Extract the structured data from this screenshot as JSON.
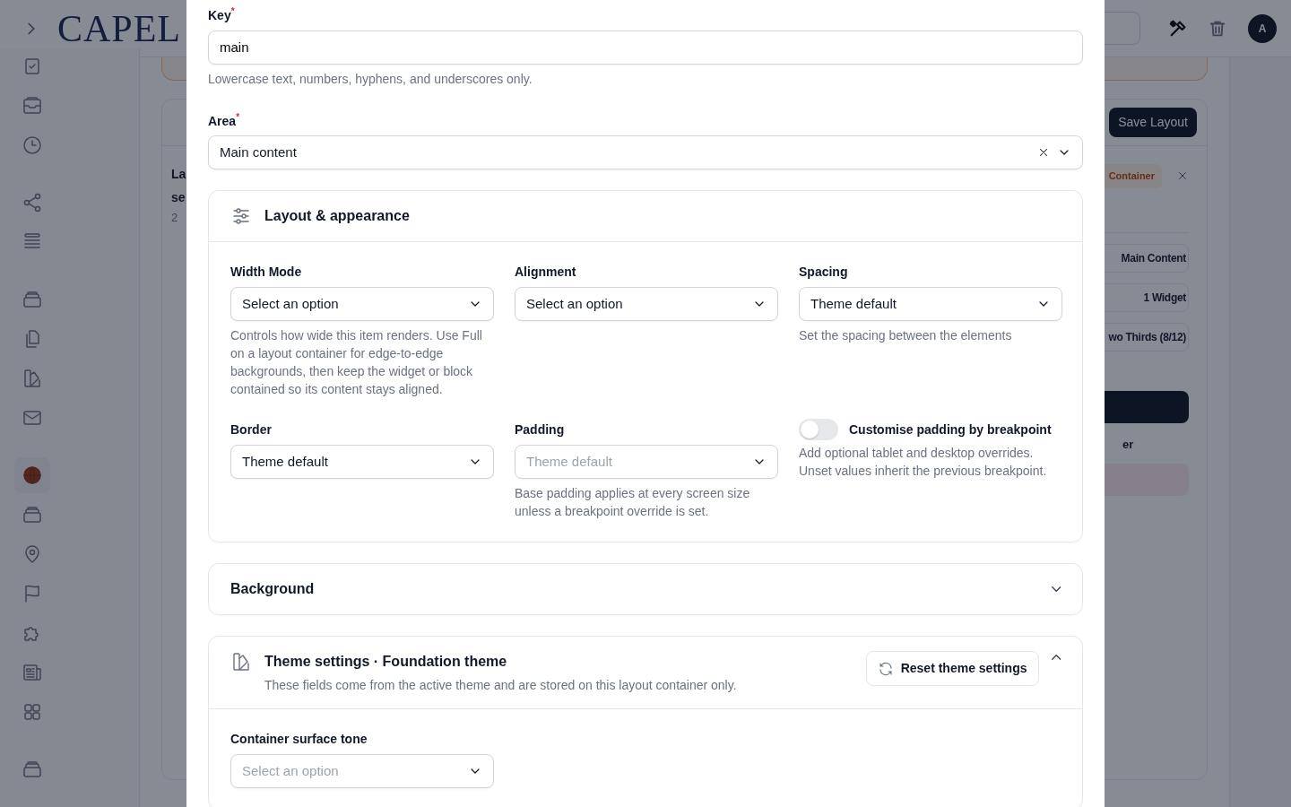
{
  "header": {
    "logo": "CAPEL",
    "avatar": "A"
  },
  "sidebar": {
    "groups": [
      [
        {
          "kind": "check",
          "selected": false
        },
        {
          "kind": "inbox",
          "selected": false
        },
        {
          "kind": "clock",
          "selected": false
        }
      ],
      [
        {
          "kind": "share",
          "selected": false
        },
        {
          "kind": "list",
          "selected": false
        }
      ],
      [
        {
          "kind": "archive",
          "selected": false
        },
        {
          "kind": "files",
          "selected": false
        },
        {
          "kind": "swatch",
          "selected": false
        },
        {
          "kind": "mail",
          "selected": false
        }
      ],
      [
        {
          "kind": "globe",
          "selected": true
        },
        {
          "kind": "archive",
          "selected": false
        },
        {
          "kind": "pin",
          "selected": false
        },
        {
          "kind": "flag",
          "selected": false
        },
        {
          "kind": "puzzle",
          "selected": false
        },
        {
          "kind": "news",
          "selected": false
        },
        {
          "kind": "grid",
          "selected": false
        }
      ],
      [
        {
          "kind": "archive",
          "selected": false
        }
      ]
    ]
  },
  "layout_card": {
    "title_lines": [
      "La",
      "se"
    ],
    "count": "2",
    "save_button": "Save Layout",
    "badge": "Container",
    "rows": [
      "Main Content",
      "1 Widget",
      "wo Thirds (8/12)"
    ],
    "footer_text": "er"
  },
  "modal": {
    "fields": [
      {
        "label": "Key",
        "required_mark": "*",
        "kind": "text",
        "value": "main",
        "help": "Lowercase text, numbers, hyphens, and underscores only."
      },
      {
        "label": "Area",
        "required_mark": "*",
        "kind": "select",
        "value": "Main content",
        "clearable": true
      }
    ],
    "sections": [
      {
        "title": "Layout & appearance",
        "kind": "sliders",
        "fields": [
          {
            "kind": "select",
            "label": "Width Mode",
            "value": "Select an option",
            "help": "Controls how wide this item renders. Use Full on a layout container for edge-to-edge backgrounds, then keep the widget or block contained so its content stays aligned."
          },
          {
            "kind": "select",
            "label": "Alignment",
            "value": "Select an option"
          },
          {
            "kind": "select",
            "label": "Spacing",
            "value": "Theme default",
            "help": "Set the spacing between the elements"
          },
          {
            "kind": "select",
            "label": "Border",
            "value": "Theme default"
          },
          {
            "kind": "select",
            "label": "Padding",
            "placeholder": "Theme default",
            "help": "Base padding applies at every screen size unless a breakpoint override is set."
          },
          {
            "kind": "toggle",
            "label": "Customise padding by breakpoint",
            "on": false,
            "help": "Add optional tablet and desktop overrides. Unset values inherit the previous breakpoint."
          }
        ]
      },
      {
        "title": "Background",
        "kind": "plain",
        "expanded": false
      },
      {
        "title": "Theme settings · Foundation theme",
        "kind": "swatch",
        "subtitle": "These fields come from the active theme and are stored on this layout container only.",
        "action": "Reset theme settings",
        "expanded": true,
        "fields": [
          {
            "kind": "select",
            "label": "Container surface tone",
            "placeholder": "Select an option"
          }
        ]
      }
    ]
  }
}
